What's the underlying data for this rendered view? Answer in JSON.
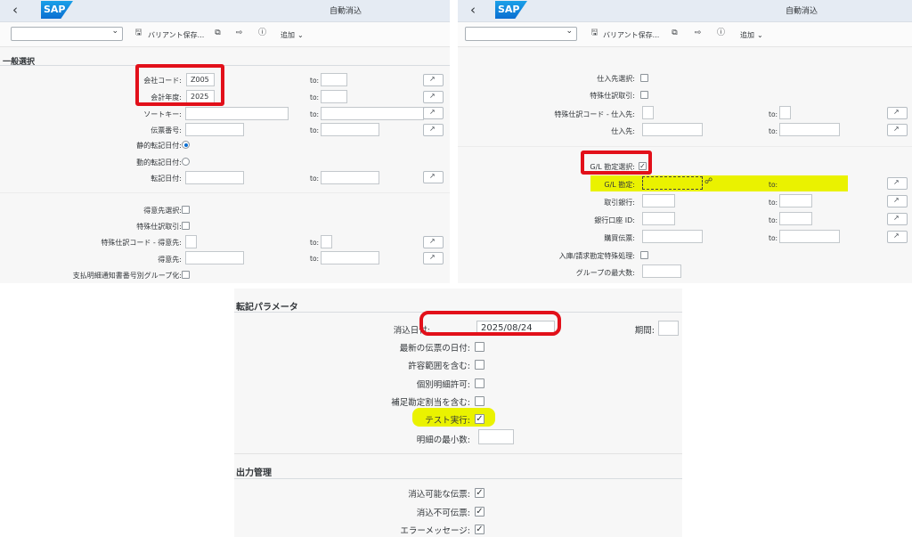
{
  "shell": {
    "back_icon": "chevron-left-icon",
    "logo_text": "SAP",
    "title": "自動消込",
    "logo_color": "#0a6ed1"
  },
  "toolbar": {
    "variant_value": "",
    "save_variant_label": "バリアント保存...",
    "add_label": "追加",
    "icons": [
      "save-icon",
      "copy-icon",
      "export-icon",
      "info-icon",
      "chevron-down-icon"
    ]
  },
  "general": {
    "header": "一般選択",
    "company_code": {
      "label": "会社コード:",
      "value": "Z005"
    },
    "fiscal_year": {
      "label": "会計年度:",
      "value": "2025"
    },
    "sort_key": {
      "label": "ソートキー:"
    },
    "doc_number": {
      "label": "伝票番号:"
    },
    "static_posting": {
      "label": "静的転記日付:"
    },
    "dynamic_posting": {
      "label": "動的転記日付:"
    },
    "posting_date": {
      "label": "転記日付:"
    },
    "customer_select": {
      "label": "得意先選択:"
    },
    "special_gl_txn": {
      "label": "特殊仕訳取引:"
    },
    "special_gl_code_customer": {
      "label": "特殊仕訳コード - 得意先:"
    },
    "customer": {
      "label": "得意先:"
    },
    "grouping_by_remittance": {
      "label": "支払明細通知書番号別グループ化:"
    },
    "to_label": "to:"
  },
  "vendor": {
    "vendor_select": {
      "label": "仕入先選択:"
    },
    "special_gl_txn": {
      "label": "特殊仕訳取引:"
    },
    "special_gl_code_vendor": {
      "label": "特殊仕訳コード - 仕入先:"
    },
    "vendor": {
      "label": "仕入先:"
    },
    "gl_account_select": {
      "label": "G/L 勘定選択:",
      "checked": true
    },
    "gl_account": {
      "label": "G/L 勘定:"
    },
    "house_bank": {
      "label": "取引銀行:"
    },
    "bank_account_id": {
      "label": "銀行口座 ID:"
    },
    "purchasing_doc": {
      "label": "購買伝票:"
    },
    "special_handling": {
      "label": "入庫/請求勘定特殊処理:"
    },
    "max_group": {
      "label": "グループの最大数:"
    },
    "to_label": "to:",
    "highlight_color": "#eaf200"
  },
  "posting": {
    "header": "転記パラメータ",
    "clearing_date": {
      "label": "消込日付:",
      "value": "2025/08/24"
    },
    "period": {
      "label": "期間:"
    },
    "latest_doc_date": {
      "label": "最新の伝票の日付:"
    },
    "include_tolerance": {
      "label": "許容範囲を含む:"
    },
    "individual_items": {
      "label": "個別明細許可:"
    },
    "include_supp_assignment": {
      "label": "補足勘定割当を含む:"
    },
    "test_run": {
      "label": "テスト実行:",
      "checked": true
    },
    "min_items": {
      "label": "明細の最小数:"
    }
  },
  "output": {
    "header": "出力管理",
    "clearable_docs": {
      "label": "消込可能な伝票:",
      "checked": true
    },
    "non_clearable_docs": {
      "label": "消込不可伝票:",
      "checked": true
    },
    "error_messages": {
      "label": "エラーメッセージ:",
      "checked": true
    }
  },
  "annotation_color": "#e2101a"
}
